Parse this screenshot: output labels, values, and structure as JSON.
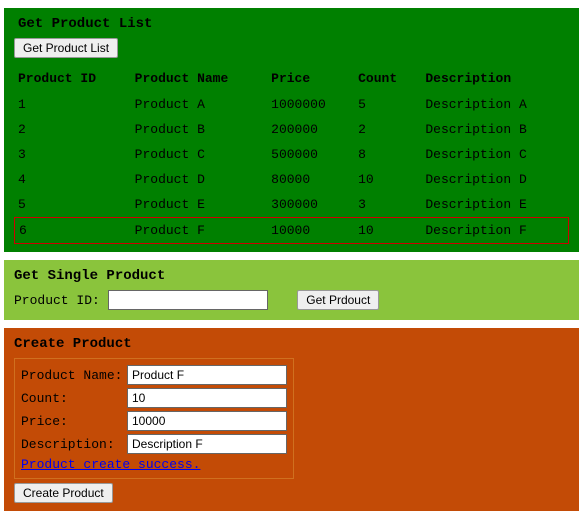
{
  "list": {
    "title": "Get Product List",
    "button": "Get Product List",
    "headers": {
      "id": "Product ID",
      "name": "Product Name",
      "price": "Price",
      "count": "Count",
      "desc": "Description"
    },
    "rows": [
      {
        "id": "1",
        "name": "Product A",
        "price": "1000000",
        "count": "5",
        "desc": "Description A"
      },
      {
        "id": "2",
        "name": "Product B",
        "price": "200000",
        "count": "2",
        "desc": "Description B"
      },
      {
        "id": "3",
        "name": "Product C",
        "price": "500000",
        "count": "8",
        "desc": "Description C"
      },
      {
        "id": "4",
        "name": "Product D",
        "price": "80000",
        "count": "10",
        "desc": "Description D"
      },
      {
        "id": "5",
        "name": "Product E",
        "price": "300000",
        "count": "3",
        "desc": "Description E"
      },
      {
        "id": "6",
        "name": "Product F",
        "price": "10000",
        "count": "10",
        "desc": "Description F"
      }
    ]
  },
  "single": {
    "title": "Get Single Product",
    "label": "Product ID:",
    "value": "",
    "button": "Get Prdouct"
  },
  "create": {
    "title": "Create Product",
    "fields": {
      "name": {
        "label": "Product Name:",
        "value": "Product F"
      },
      "count": {
        "label": "Count:",
        "value": "10"
      },
      "price": {
        "label": "Price:",
        "value": "10000"
      },
      "desc": {
        "label": "Description:",
        "value": "Description F"
      }
    },
    "message": "Product create success.",
    "button": "Create Product"
  }
}
